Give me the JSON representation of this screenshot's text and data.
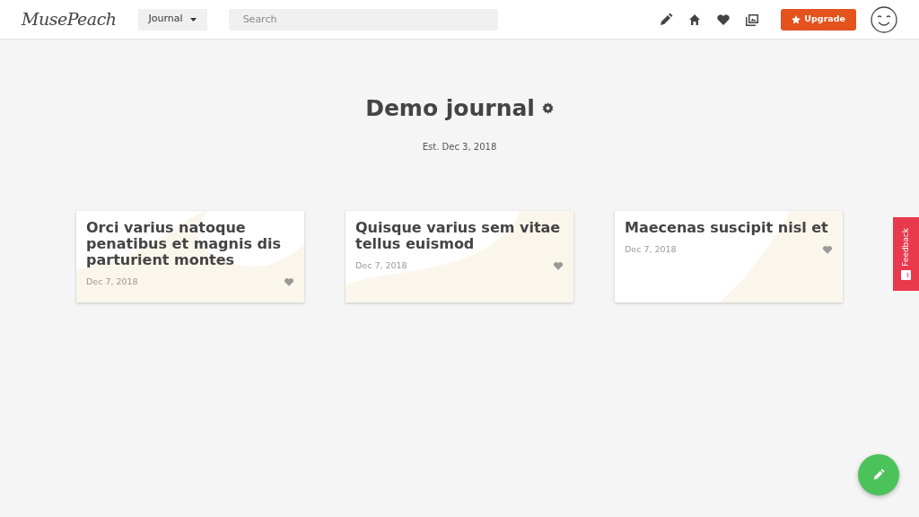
{
  "navbar": {
    "logo": "MusePeach",
    "journal_menu": "Journal",
    "search": {
      "placeholder": "Search"
    },
    "upgrade": "Upgrade"
  },
  "journal": {
    "title": "Demo journal",
    "established": "Est. Dec 3, 2018"
  },
  "entries": [
    {
      "title": "Orci varius natoque penatibus et magnis dis parturient montes",
      "date": "Dec 7, 2018"
    },
    {
      "title": "Quisque varius sem vitae tellus euismod",
      "date": "Dec 7, 2018"
    },
    {
      "title": "Maecenas suscipit nisl et",
      "date": "Dec 7, 2018"
    }
  ],
  "feedback": "Feedback"
}
